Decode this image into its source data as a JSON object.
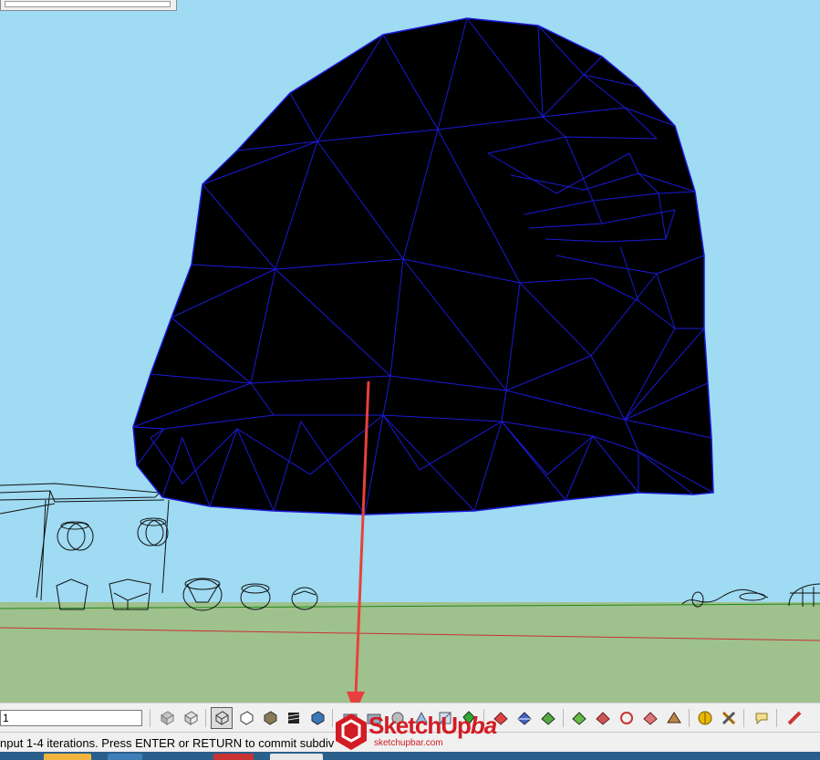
{
  "vcb": {
    "value": "1"
  },
  "status": {
    "text": "nput 1-4 iterations.  Press ENTER or RETURN to commit subdiv"
  },
  "watermark": {
    "brand": "SketchUp",
    "suffix": "ba",
    "url": "sketchupbar.com"
  },
  "colors": {
    "sky": "#9fdbf3",
    "ground": "#9fc18d",
    "mesh_fill": "#000000",
    "mesh_edge": "#1a1ad8",
    "annotation_arrow": "#e8403c",
    "red_axis": "#c83232",
    "green_axis": "#1f8a1f"
  },
  "toolbar": {
    "icons": [
      "face-style-icon",
      "face-style-icon",
      "wireframe-icon",
      "hidden-line-icon",
      "shaded-icon",
      "shaded-texture-icon",
      "monochrome-icon",
      "camera-icon",
      "camera-icon",
      "camera-icon",
      "camera-icon",
      "camera-icon",
      "camera-icon",
      "subdivide-icon",
      "subdivide-icon",
      "subdivide-icon",
      "subdivide-icon",
      "subdivide-icon",
      "subdivide-icon",
      "subdivide-icon",
      "subdivide-icon",
      "subdivide-icon",
      "subdivide-icon",
      "subdivide-icon",
      "geo-location-icon",
      "tools-icon",
      "speech-bubble-icon",
      "pencil-icon"
    ],
    "active_index": 2
  }
}
